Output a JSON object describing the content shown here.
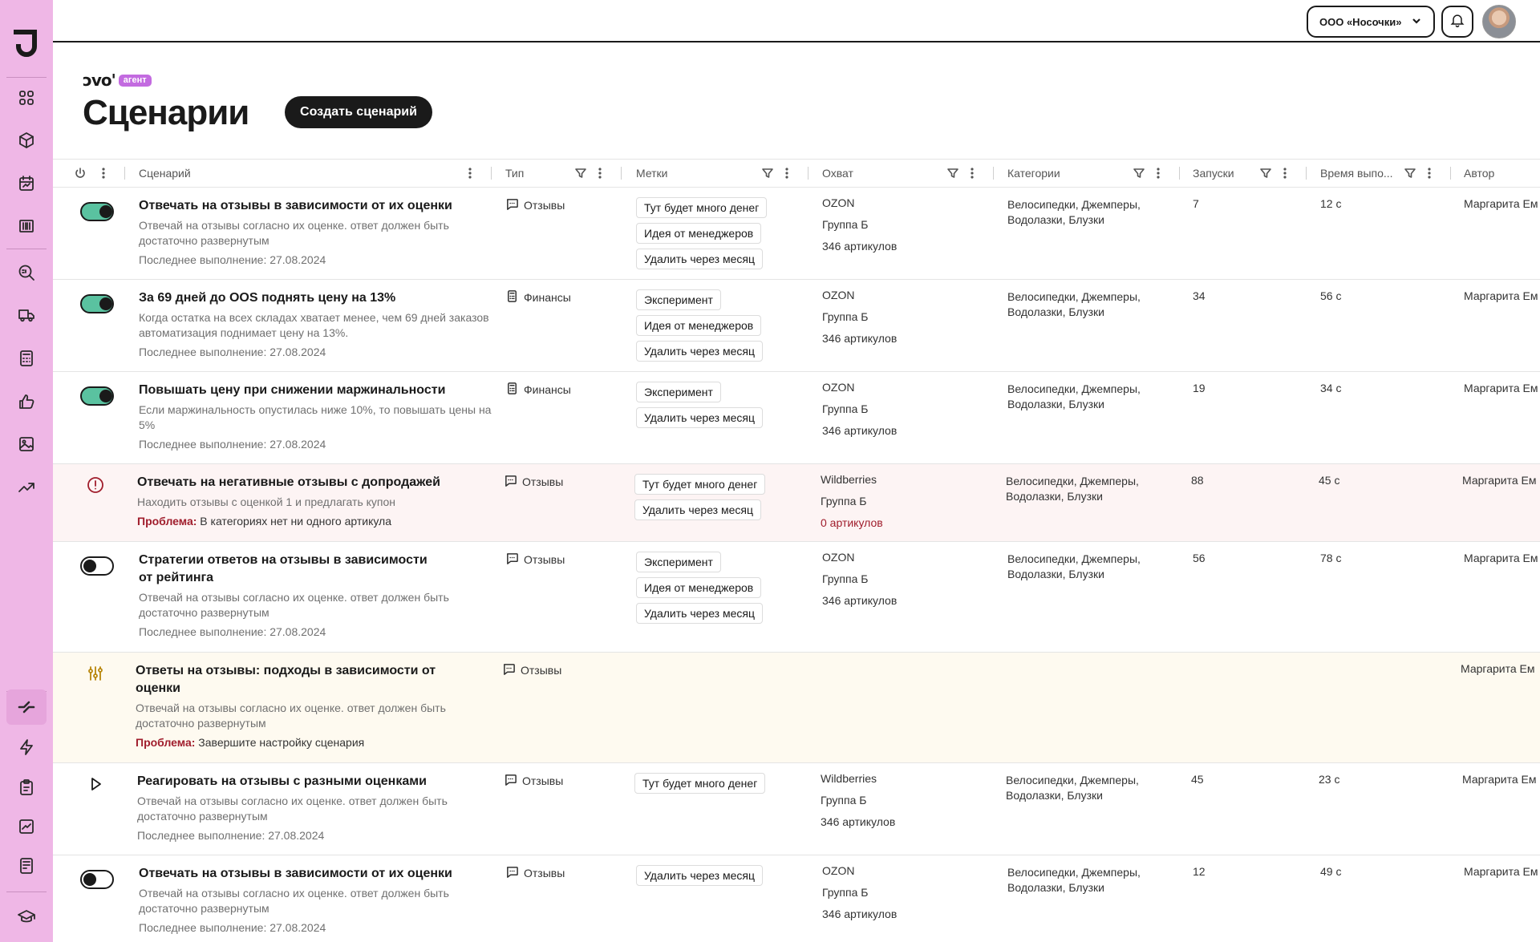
{
  "topbar": {
    "org": "ООО «Носочки»"
  },
  "header": {
    "brand": "ɔvo'",
    "brand_badge": "агент",
    "title": "Сценарии",
    "create_button": "Создать сценарий"
  },
  "table": {
    "columns": {
      "scenario": "Сценарий",
      "type": "Тип",
      "tags": "Метки",
      "coverage": "Охват",
      "categories": "Категории",
      "runs": "Запуски",
      "duration": "Время выпо...",
      "author": "Автор"
    },
    "rows": [
      {
        "status": "on",
        "title": "Отвечать на отзывы в зависимости от их оценки",
        "desc": "Отвечай на отзывы согласно их оценке. ответ должен быть достаточно развернутым",
        "last": "Последнее выполнение: 27.08.2024",
        "type": "Отзывы",
        "type_icon": "chat-icon",
        "tags": [
          "Тут будет много денег",
          "Идея от менеджеров",
          "Удалить через месяц"
        ],
        "platform": "OZON",
        "group": "Группа Б",
        "articles": "346 артикулов",
        "categories": "Велосипедки, Джемперы, Водолазки, Блузки",
        "runs": "7",
        "duration": "12 с",
        "author": "Маргарита Ем"
      },
      {
        "status": "on",
        "title": "За 69 дней до OOS поднять цену на 13%",
        "desc": "Когда остатка на всех складах хватает менее, чем 69 дней заказов автоматизация поднимает цену на 13%.",
        "last": "Последнее выполнение: 27.08.2024",
        "type": "Финансы",
        "type_icon": "calculator-icon",
        "tags": [
          "Эксперимент",
          "Идея от менеджеров",
          "Удалить через месяц"
        ],
        "platform": "OZON",
        "group": "Группа Б",
        "articles": "346 артикулов",
        "categories": "Велосипедки, Джемперы, Водолазки, Блузки",
        "runs": "34",
        "duration": "56 с",
        "author": "Маргарита Ем"
      },
      {
        "status": "on",
        "title": "Повышать цену при снижении маржинальности",
        "desc": "Если маржинальность опустилась ниже 10%, то повышать цены на 5%",
        "last": "Последнее выполнение: 27.08.2024",
        "type": "Финансы",
        "type_icon": "calculator-icon",
        "tags": [
          "Эксперимент",
          "Удалить через месяц"
        ],
        "platform": "OZON",
        "group": "Группа Б",
        "articles": "346 артикулов",
        "categories": "Велосипедки, Джемперы, Водолазки, Блузки",
        "runs": "19",
        "duration": "34 с",
        "author": "Маргарита Ем"
      },
      {
        "status": "error",
        "title": "Отвечать на негативные отзывы с допродажей",
        "desc": "Находить отзывы с оценкой 1 и предлагать купон",
        "problem_label": "Проблема:",
        "problem": "В категориях нет ни одного артикула",
        "type": "Отзывы",
        "type_icon": "chat-icon",
        "tags": [
          "Тут будет много денег",
          "Удалить через месяц"
        ],
        "platform": "Wildberries",
        "group": "Группа Б",
        "articles": "0 артикулов",
        "categories": "Велосипедки, Джемперы, Водолазки, Блузки",
        "runs": "88",
        "duration": "45 с",
        "author": "Маргарита Ем"
      },
      {
        "status": "off",
        "title": "Стратегии ответов на отзывы в зависимости от рейтинга",
        "desc": "Отвечай на отзывы согласно их оценке. ответ должен быть достаточно развернутым",
        "last": "Последнее выполнение: 27.08.2024",
        "type": "Отзывы",
        "type_icon": "chat-icon",
        "tags": [
          "Эксперимент",
          "Идея от менеджеров",
          "Удалить через месяц"
        ],
        "platform": "OZON",
        "group": "Группа Б",
        "articles": "346 артикулов",
        "categories": "Велосипедки, Джемперы, Водолазки, Блузки",
        "runs": "56",
        "duration": "78 с",
        "author": "Маргарита Ем"
      },
      {
        "status": "draft",
        "title": "Ответы на отзывы: подходы в зависимости от оценки",
        "desc": "Отвечай на отзывы согласно их оценке. ответ должен быть достаточно развернутым",
        "problem_label": "Проблема:",
        "problem": "Завершите настройку сценария",
        "type": "Отзывы",
        "type_icon": "chat-icon",
        "author": "Маргарита Ем"
      },
      {
        "status": "play",
        "title": "Реагировать на отзывы с разными оценками",
        "desc": "Отвечай на отзывы согласно их оценке. ответ должен быть достаточно развернутым",
        "last": "Последнее выполнение: 27.08.2024",
        "type": "Отзывы",
        "type_icon": "chat-icon",
        "tags": [
          "Тут будет много денег"
        ],
        "platform": "Wildberries",
        "group": "Группа Б",
        "articles": "346 артикулов",
        "categories": "Велосипедки, Джемперы, Водолазки, Блузки",
        "runs": "45",
        "duration": "23 с",
        "author": "Маргарита Ем"
      },
      {
        "status": "off",
        "title": "Отвечать на отзывы в зависимости от их оценки",
        "desc": "Отвечай на отзывы согласно их оценке. ответ должен быть достаточно развернутым",
        "last": "Последнее выполнение: 27.08.2024",
        "type": "Отзывы",
        "type_icon": "chat-icon",
        "tags": [
          "Удалить через месяц"
        ],
        "platform": "OZON",
        "group": "Группа Б",
        "articles": "346 артикулов",
        "categories": "Велосипедки, Джемперы, Водолазки, Блузки",
        "runs": "12",
        "duration": "49 с",
        "author": "Маргарита Ем"
      }
    ]
  },
  "colors": {
    "sidebar": "#efb7e6",
    "accent": "#c36be0",
    "toggle_on": "#5ac2a0",
    "error": "#a01d2c",
    "warn_row": "#fdf4f4",
    "draft_row": "#fefaf0"
  }
}
